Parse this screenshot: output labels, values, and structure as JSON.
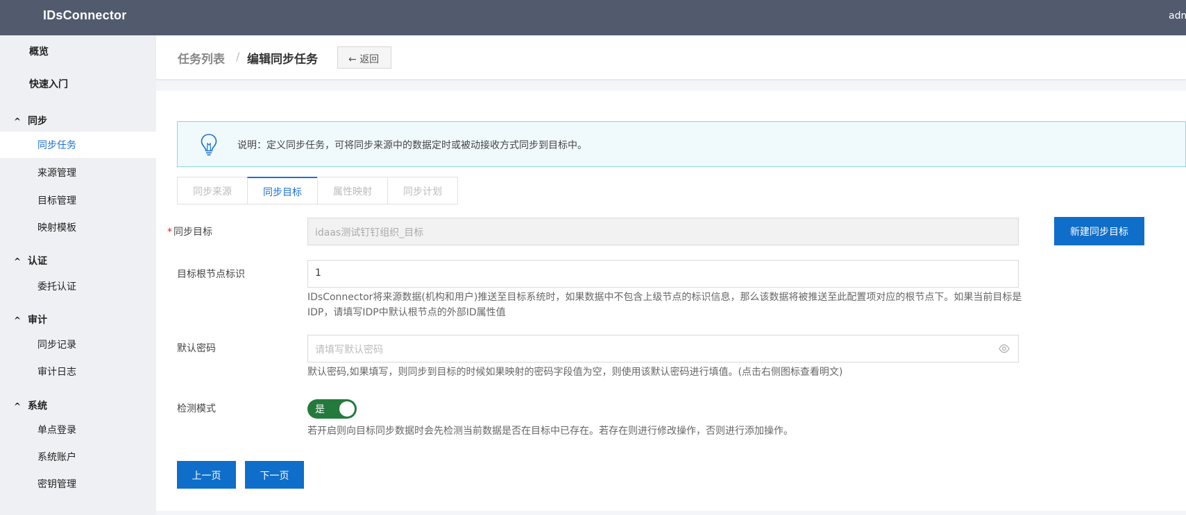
{
  "app": {
    "title": "IDsConnector",
    "user": "adm"
  },
  "sidebar": {
    "top_items": [
      {
        "label": "概览"
      },
      {
        "label": "快速入门"
      }
    ],
    "groups": [
      {
        "label": "同步",
        "items": [
          {
            "label": "同步任务",
            "active": true
          },
          {
            "label": "来源管理"
          },
          {
            "label": "目标管理"
          },
          {
            "label": "映射模板"
          }
        ]
      },
      {
        "label": "认证",
        "items": [
          {
            "label": "委托认证"
          }
        ]
      },
      {
        "label": "审计",
        "items": [
          {
            "label": "同步记录"
          },
          {
            "label": "审计日志"
          }
        ]
      },
      {
        "label": "系统",
        "items": [
          {
            "label": "单点登录"
          },
          {
            "label": "系统账户"
          },
          {
            "label": "密钥管理"
          }
        ]
      }
    ],
    "caret_glyph": "^"
  },
  "breadcrumb": {
    "parent": "任务列表",
    "separator": "/",
    "current": "编辑同步任务",
    "back_label": "返回",
    "back_arrow": "←"
  },
  "notice": {
    "text": "说明：定义同步任务，可将同步来源中的数据定时或被动接收方式同步到目标中。",
    "icon": "lightbulb-icon"
  },
  "tabs": [
    {
      "label": "同步来源"
    },
    {
      "label": "同步目标",
      "active": true
    },
    {
      "label": "属性映射"
    },
    {
      "label": "同步计划"
    }
  ],
  "form": {
    "target": {
      "required_mark": "*",
      "label": "同步目标",
      "value": "idaas测试钉钉组织_目标",
      "new_button": "新建同步目标"
    },
    "root_node": {
      "label": "目标根节点标识",
      "value": "1",
      "help": "IDsConnector将来源数据(机构和用户)推送至目标系统时，如果数据中不包含上级节点的标识信息，那么该数据将被推送至此配置项对应的根节点下。如果当前目标是IDP，请填写IDP中默认根节点的外部ID属性值"
    },
    "password": {
      "label": "默认密码",
      "placeholder": "请填写默认密码",
      "help": "默认密码,如果填写，则同步到目标的时候如果映射的密码字段值为空，则使用该默认密码进行填值。(点击右侧图标查看明文)"
    },
    "detect": {
      "label": "检测模式",
      "toggle_label": "是",
      "enabled": true,
      "help": "若开启则向目标同步数据时会先检测当前数据是否在目标中已存在。若存在则进行修改操作，否则进行添加操作。"
    }
  },
  "actions": {
    "prev": "上一页",
    "next": "下一页"
  },
  "colors": {
    "topbar": "#525a6e",
    "primary": "#0f6ec9",
    "active_text": "#1a6fd1",
    "toggle_on": "#237a3c",
    "notice_border": "#8ad4e0",
    "required": "#e02020"
  }
}
